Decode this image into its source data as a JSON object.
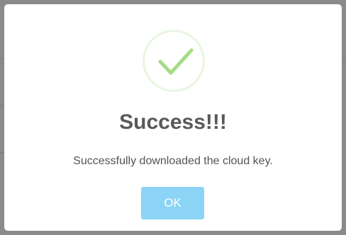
{
  "dialog": {
    "title": "Success!!!",
    "message": "Successfully downloaded the cloud key.",
    "ok_label": "OK",
    "icon": "success-checkmark-icon"
  },
  "colors": {
    "checkmark": "#a5dc86",
    "ok_button": "#8cd4f5",
    "title": "#595959",
    "overlay": "#8a8a8a"
  }
}
